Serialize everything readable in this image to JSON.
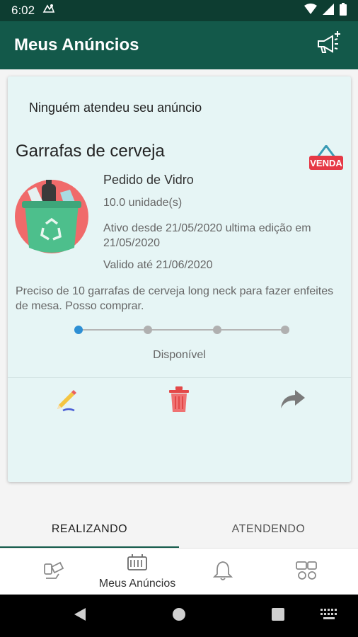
{
  "status_bar": {
    "time": "6:02"
  },
  "app_bar": {
    "title": "Meus Anúncios",
    "action_icon": "megaphone-add-icon"
  },
  "ad": {
    "note": "Ninguém atendeu seu anúncio",
    "title": "Garrafas de cerveja",
    "badge": "VENDA",
    "category": "Pedido de Vidro",
    "quantity": "10.0 unidade(s)",
    "active_since": "Ativo desde 21/05/2020 ultima edição em 21/05/2020",
    "valid_until": "Valido até 21/06/2020",
    "description": "Preciso de 10 garrafas de cerveja long neck para fazer enfeites de mesa. Posso comprar.",
    "progress": {
      "steps": 4,
      "current_step": 1
    },
    "status": "Disponível",
    "actions": {
      "edit": "pencil-icon",
      "delete": "trash-icon",
      "share": "share-arrow-icon"
    }
  },
  "tabs": [
    {
      "label": "REALIZANDO",
      "active": true
    },
    {
      "label": "ATENDENDO",
      "active": false
    }
  ],
  "bottom_nav": [
    {
      "icon": "recycle-items-icon",
      "label": ""
    },
    {
      "icon": "announcements-icon",
      "label": "Meus Anúncios",
      "active": true
    },
    {
      "icon": "bell-icon",
      "label": ""
    },
    {
      "icon": "offers-icon",
      "label": ""
    }
  ],
  "colors": {
    "status_bar": "#0d3d31",
    "primary": "#13594a",
    "card_bg": "#e6f5f5",
    "progress_active": "#2d8fd4",
    "badge_red": "#e63946"
  }
}
